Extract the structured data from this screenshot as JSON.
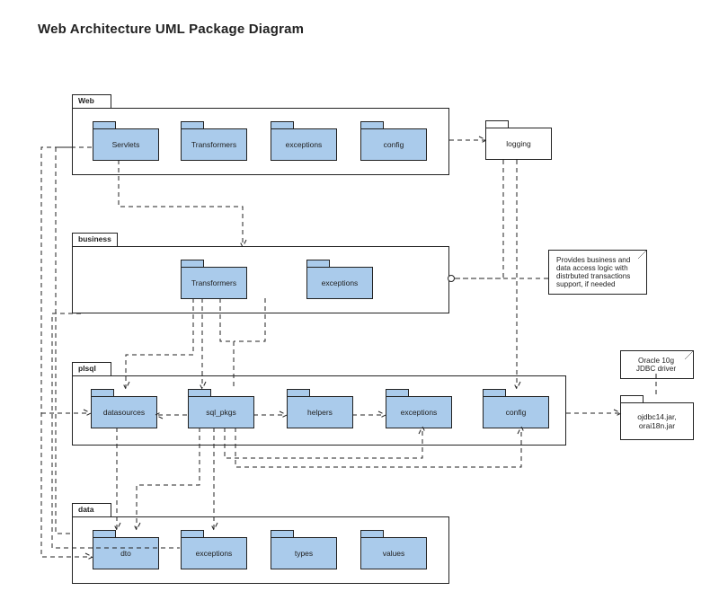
{
  "title": "Web Architecture UML Package Diagram",
  "colors": {
    "package_fill": "#aacbeb",
    "line": "#222222"
  },
  "note_business": "Provides business and data access logic with distrbuted transactions support, if needed",
  "note_driver": "Oracle 10g JDBC driver",
  "containers": {
    "web": {
      "label": "Web",
      "packages": [
        "Servlets",
        "Transformers",
        "exceptions",
        "config"
      ]
    },
    "business": {
      "label": "business",
      "packages": [
        "Transformers",
        "exceptions"
      ]
    },
    "plsql": {
      "label": "plsql",
      "packages": [
        "datasources",
        "sql_pkgs",
        "helpers",
        "exceptions",
        "config"
      ]
    },
    "data": {
      "label": "data",
      "packages": [
        "dto",
        "exceptions",
        "types",
        "values"
      ]
    }
  },
  "logging_label": "logging",
  "driver_label": "ojdbc14.jar, orai18n.jar",
  "dependencies_outline": [
    "Web.Servlets -> business (container)",
    "Web.Servlets -> plsql.datasources",
    "Web.Servlets -> data.exceptions",
    "Web.Servlets -> data.dto",
    "Web (container) -> logging",
    "logging -> plsql.config",
    "logging -> business (container)",
    "business.Transformers -> plsql.sql_pkgs",
    "business.Transformers -> plsql.datasources",
    "business.exceptions -> plsql.sql_pkgs",
    "business (container) -> data.dto",
    "plsql.sql_pkgs -> plsql.datasources",
    "plsql.sql_pkgs -> plsql.helpers",
    "plsql.helpers -> plsql.exceptions",
    "plsql.config -> driver",
    "plsql.datasources -> data.dto",
    "plsql.sql_pkgs -> data.exceptions",
    "plsql.sql_pkgs -> data.dto",
    "plsql.sql_pkgs -> plsql.config",
    "plsql.sql_pkgs -> plsql.exceptions",
    "note_business -> business (container)",
    "note_driver -> driver"
  ]
}
